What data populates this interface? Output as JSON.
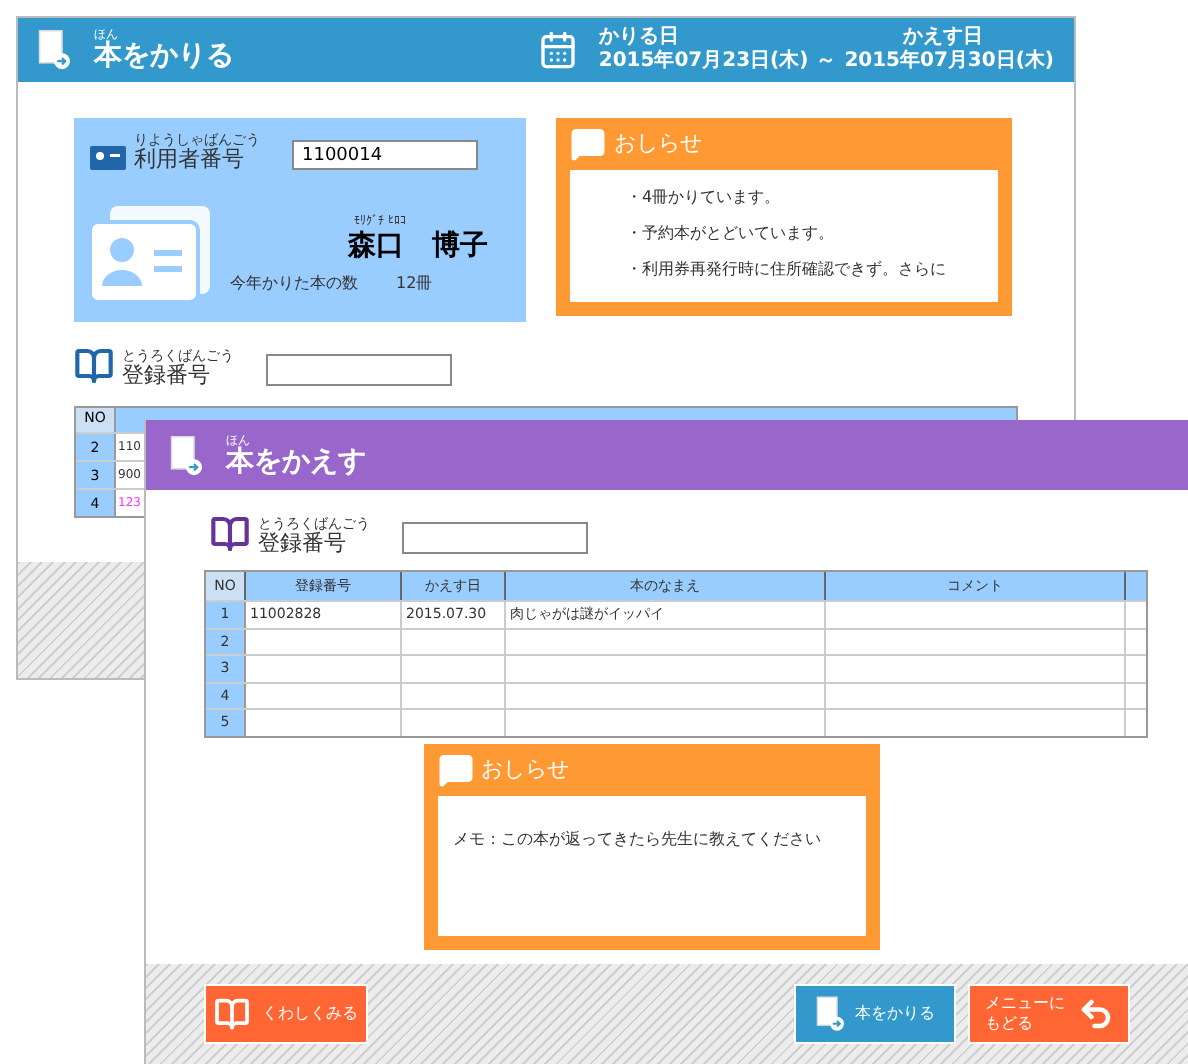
{
  "borrow_window": {
    "title_ruby": "ほん",
    "title": "本をかりる",
    "borrow_date_label": "かりる日",
    "borrow_date": "2015年07月23日(木)",
    "separator": "～",
    "return_date_label": "かえす日",
    "return_date": "2015年07月30日(木)",
    "user_card": {
      "label_ruby": "りようしゃばんごう",
      "label": "利用者番号",
      "user_number": "1100014",
      "name_ruby": "ﾓﾘｸﾞﾁ ﾋﾛｺ",
      "name": "森口　博子",
      "count_label": "今年かりた本の数",
      "count": "12冊"
    },
    "notice": {
      "title": "おしらせ",
      "items": [
        "・4冊かりています。",
        "・予約本がとどいています。",
        "・利用券再発行時に住所確認できず。さらに"
      ]
    },
    "registration": {
      "label_ruby": "とうろくばんごう",
      "label": "登録番号"
    },
    "table": {
      "columns": [
        "NO"
      ],
      "rows": [
        {
          "no": "2",
          "cell": "110",
          "color": "#333333"
        },
        {
          "no": "3",
          "cell": "900",
          "color": "#333333"
        },
        {
          "no": "4",
          "cell": "123",
          "color": "#ff33ff"
        }
      ]
    }
  },
  "return_window": {
    "title_ruby": "ほん",
    "title": "本をかえす",
    "registration": {
      "label_ruby": "とうろくばんごう",
      "label": "登録番号"
    },
    "table": {
      "columns": [
        "NO",
        "登録番号",
        "かえす日",
        "本のなまえ",
        "コメント"
      ],
      "rows": [
        {
          "cells": [
            "1",
            "11002828",
            "2015.07.30",
            "肉じゃがは謎がイッパイ",
            ""
          ]
        },
        {
          "cells": [
            "2",
            "",
            "",
            "",
            ""
          ]
        },
        {
          "cells": [
            "3",
            "",
            "",
            "",
            ""
          ]
        },
        {
          "cells": [
            "4",
            "",
            "",
            "",
            ""
          ]
        },
        {
          "cells": [
            "5",
            "",
            "",
            "",
            ""
          ]
        }
      ]
    },
    "notice": {
      "title": "おしらせ",
      "message": "メモ：この本が返ってきたら先生に教えてください"
    },
    "buttons": [
      {
        "kind": "details",
        "label": "くわしくみる"
      },
      {
        "kind": "borrow",
        "label": "本をかりる"
      },
      {
        "kind": "menu",
        "label_lines": [
          "メニューに",
          "もどる"
        ]
      }
    ]
  }
}
